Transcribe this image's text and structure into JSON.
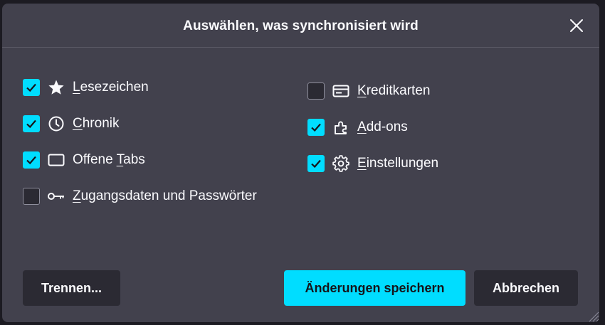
{
  "dialog": {
    "title": "Auswählen, was synchronisiert wird",
    "close_icon": "close-icon"
  },
  "options_left": [
    {
      "id": "bookmarks",
      "accel": "L",
      "rest": "esezeichen",
      "checked": true,
      "icon": "star-icon"
    },
    {
      "id": "history",
      "accel": "C",
      "rest": "hronik",
      "checked": true,
      "icon": "clock-icon"
    },
    {
      "id": "open-tabs",
      "prefix": "Offene ",
      "accel": "T",
      "rest": "abs",
      "checked": true,
      "icon": "tab-icon"
    },
    {
      "id": "logins",
      "accel": "Z",
      "rest": "ugangsdaten und Passwörter",
      "checked": false,
      "icon": "key-icon"
    }
  ],
  "options_right": [
    {
      "id": "credit-cards",
      "accel": "K",
      "rest": "reditkarten",
      "checked": false,
      "icon": "credit-card-icon"
    },
    {
      "id": "addons",
      "accel": "A",
      "rest": "dd-ons",
      "checked": true,
      "icon": "puzzle-icon"
    },
    {
      "id": "settings",
      "accel": "E",
      "rest": "instellungen",
      "checked": true,
      "icon": "gear-icon"
    }
  ],
  "buttons": {
    "disconnect": "Trennen...",
    "save": "Änderungen speichern",
    "cancel": "Abbrechen"
  },
  "colors": {
    "dialog_bg": "#42414d",
    "accent": "#00ddff",
    "button_bg": "#2b2a33",
    "text": "#fbfbfe"
  }
}
